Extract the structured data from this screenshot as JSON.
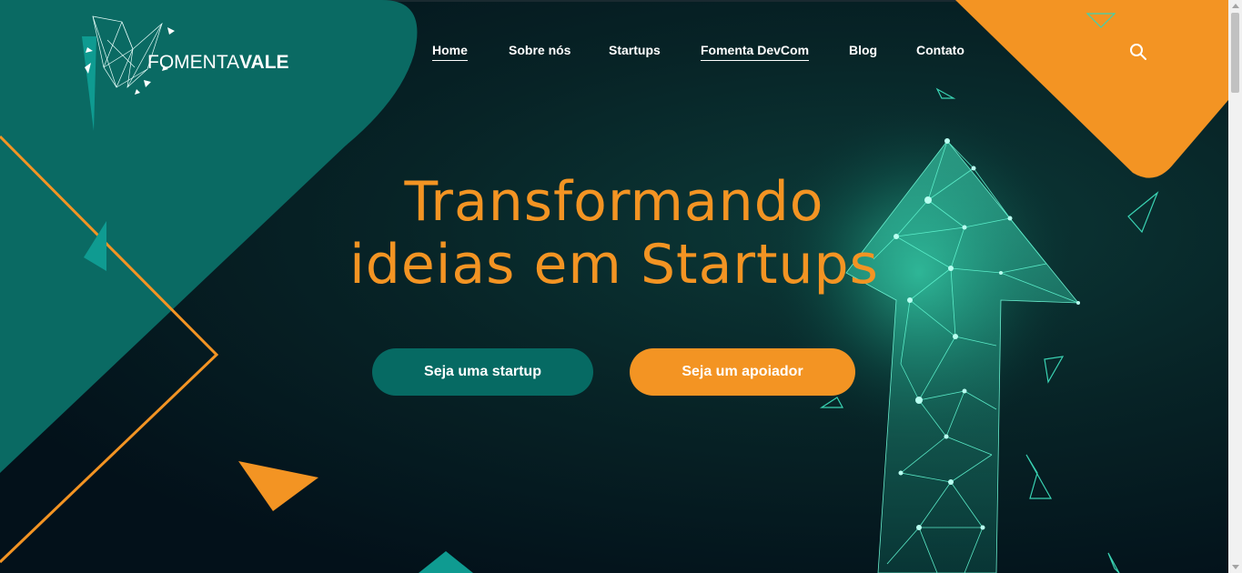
{
  "brand": {
    "logo_light": "FOMENTA",
    "logo_bold": "VALE"
  },
  "nav": {
    "items": [
      {
        "label": "Home",
        "active": true
      },
      {
        "label": "Sobre nós",
        "active": false
      },
      {
        "label": "Startups",
        "active": false
      },
      {
        "label": "Fomenta DevCom",
        "active": false
      },
      {
        "label": "Blog",
        "active": false
      },
      {
        "label": "Contato",
        "active": false
      }
    ],
    "search_icon": "search-icon"
  },
  "hero": {
    "title_line1": "Transformando",
    "title_line2": "ideias em Startups",
    "primary_button": "Seja uma startup",
    "secondary_button": "Seja um apoiador"
  },
  "colors": {
    "accent_orange": "#f39423",
    "accent_teal": "#066a63",
    "panel_teal": "#0a6a63",
    "background_dark": "#04151a",
    "glow": "#3ff0c0"
  }
}
